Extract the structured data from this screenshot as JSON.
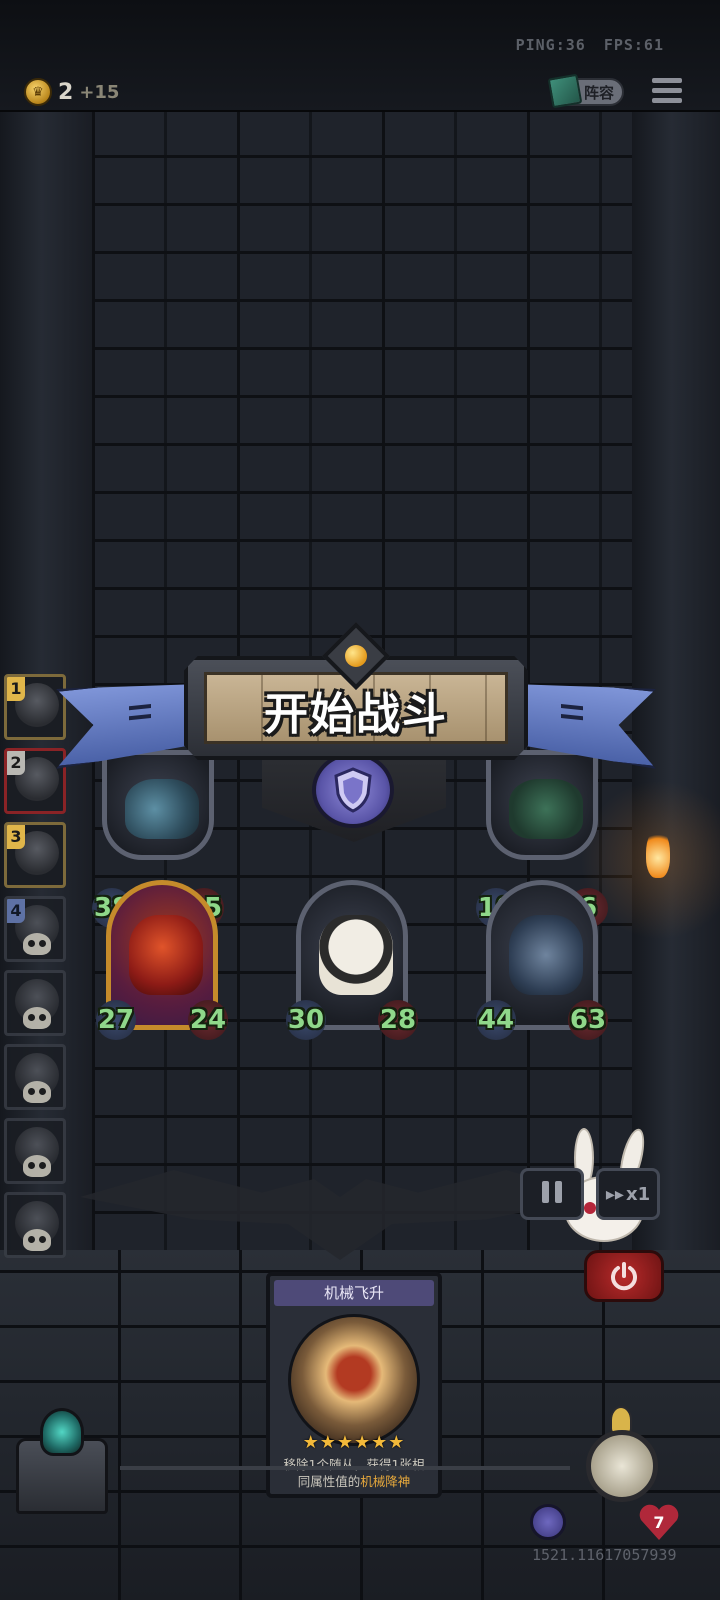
{
  "hud": {
    "ping": "PING:36",
    "fps": "FPS:61",
    "coins": "2",
    "coin_bonus": "+15",
    "lineup_label": "阵容"
  },
  "roster": [
    {
      "rank": "1",
      "state": "alive",
      "color": "gold"
    },
    {
      "rank": "2",
      "state": "alive",
      "color": "red"
    },
    {
      "rank": "3",
      "state": "alive",
      "color": "gold"
    },
    {
      "rank": "4",
      "state": "dead",
      "color": "blue"
    },
    {
      "rank": "",
      "state": "dead"
    },
    {
      "rank": "",
      "state": "dead"
    },
    {
      "rank": "",
      "state": "dead"
    },
    {
      "rank": "",
      "state": "dead"
    }
  ],
  "enemy_board": [
    {
      "attack": "38",
      "health": "35"
    },
    {
      "attack": "10",
      "health": "6"
    }
  ],
  "player_board": [
    {
      "attack": "27",
      "health": "24"
    },
    {
      "attack": "30",
      "health": "28"
    },
    {
      "attack": "44",
      "health": "63"
    }
  ],
  "banner": {
    "title": "开始战斗"
  },
  "controls": {
    "speed_label": "x1"
  },
  "card": {
    "name": "机械飞升",
    "stars": "★★★★★★",
    "desc_pre": "移除1个随从，获得1张相同属性值的",
    "desc_highlight": "机械降神"
  },
  "player": {
    "health": "7",
    "uid": "1521.11617057939"
  },
  "colors": {
    "stat_text": "#8fd88a",
    "banner_ribbon": "#6b82c8",
    "power_button": "#b92a2a"
  }
}
